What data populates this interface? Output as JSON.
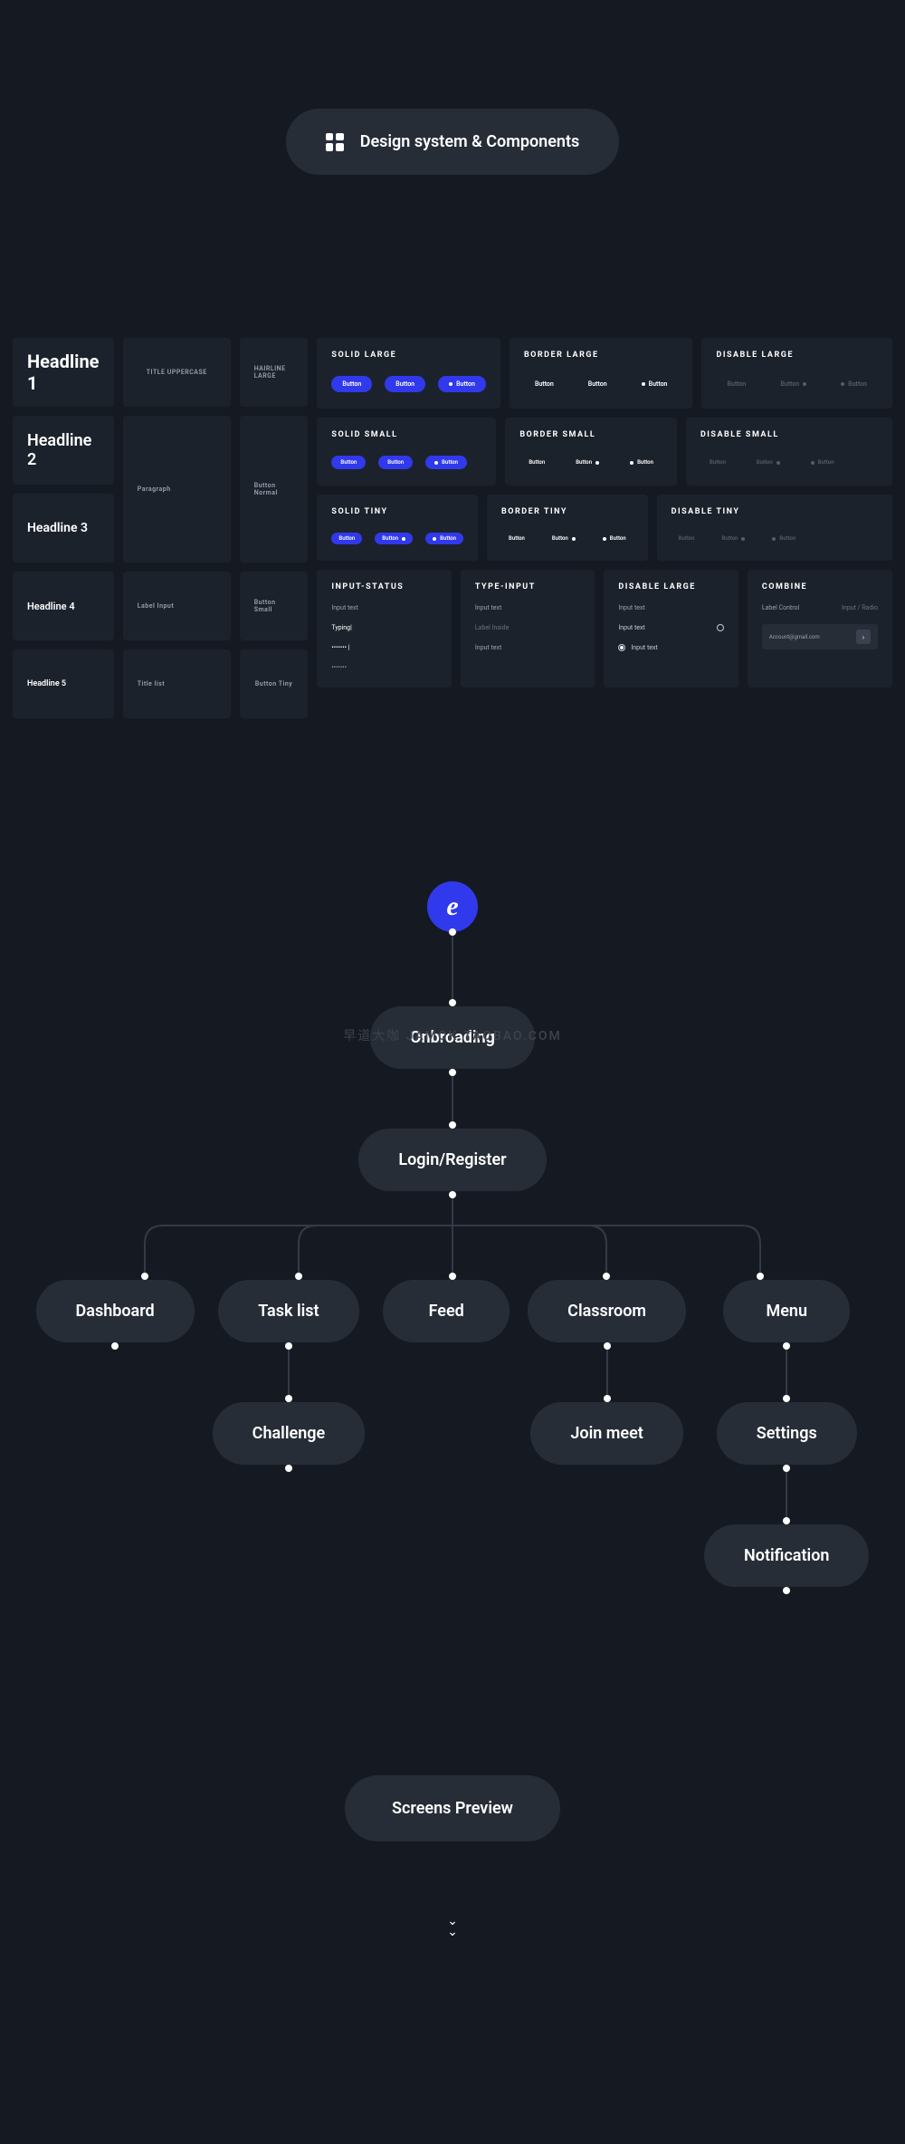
{
  "header": {
    "title": "Design system & Components"
  },
  "headlines": {
    "h1": "Headline 1",
    "h2": "Headline 2",
    "h3": "Headline 3",
    "h4": "Headline 4",
    "h5": "Headline 5"
  },
  "textSamples": {
    "titleUpper": "TITLE UPPERCASE",
    "paragraph": "Paragraph",
    "labelInput": "Label Input",
    "titleList": "Title list"
  },
  "hairlines": {
    "large": "HAIRLINE LARGE",
    "normal": "Button Normal",
    "small": "Button Small",
    "tiny": "Button Tiny"
  },
  "buttonLabel": "Button",
  "btnCards": {
    "solidLarge": "Solid large",
    "borderLarge": "Border large",
    "disableLarge": "Disable large",
    "solidSmall": "Solid small",
    "borderSmall": "Border small",
    "disableSmall": "Disable small",
    "solidTiny": "Solid tiny",
    "borderTiny": "Border tiny",
    "disableTiny": "Disable tiny"
  },
  "inputCards": {
    "status": {
      "title": "Input-status",
      "v1": "Input text",
      "v2": "Typing|",
      "v3": "••••••• |",
      "v4": "•••••••"
    },
    "type": {
      "title": "Type-input",
      "v1": "Input text",
      "v2": "Label Inside",
      "v3": "Input text"
    },
    "disable": {
      "title": "Disable large",
      "v1": "Input text",
      "v2": "Input text",
      "v3": "Input text"
    },
    "combine": {
      "title": "Combine",
      "label": "Label Control",
      "hint": "Input / Radio",
      "email": "Account@gmail.com"
    }
  },
  "watermark": "早道大咖  JAMOK.TAOBAO.COM",
  "flow": {
    "logo": "e",
    "n1": "Onbroading",
    "n2": "Login/Register",
    "row": {
      "a": "Dashboard",
      "b": "Task list",
      "c": "Feed",
      "d": "Classroom",
      "e": "Menu"
    },
    "r2": {
      "b": "Challenge",
      "d": "Join meet",
      "e": "Settings"
    },
    "r3": {
      "e": "Notification"
    }
  },
  "screens": {
    "title": "Screens Preview"
  }
}
